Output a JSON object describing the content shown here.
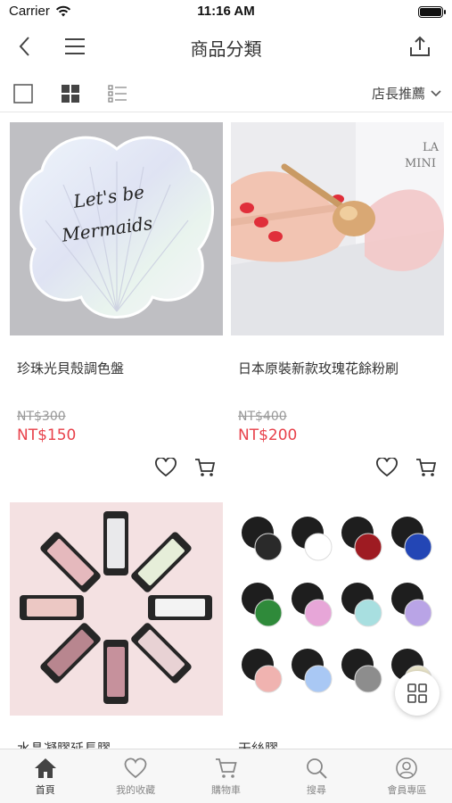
{
  "status": {
    "carrier": "Carrier",
    "time": "11:16 AM"
  },
  "nav": {
    "title": "商品分類",
    "back_icon": "chevron-left-icon",
    "menu_icon": "menu-icon",
    "share_icon": "share-icon"
  },
  "toolbar": {
    "sort_label": "店長推薦",
    "views": [
      "single-view-icon",
      "grid-view-icon",
      "list-view-icon"
    ],
    "active_view": "grid"
  },
  "products": [
    {
      "name": "珍珠光貝殼調色盤",
      "old_price": "NT$300",
      "price": "NT$150",
      "image_text_1": "Let's be",
      "image_text_2": "Mermaids"
    },
    {
      "name": "日本原裝新款玫瑰花餘粉刷",
      "old_price": "NT$400",
      "price": "NT$200",
      "image_text_1": "LA",
      "image_text_2": "MINI"
    },
    {
      "name": "水晶凝膠延長膠"
    },
    {
      "name": "天絲膠"
    }
  ],
  "tabs": [
    {
      "label": "首頁",
      "icon": "home-icon",
      "active": true
    },
    {
      "label": "我的收藏",
      "icon": "heart-icon",
      "active": false
    },
    {
      "label": "購物車",
      "icon": "cart-icon",
      "active": false
    },
    {
      "label": "搜尋",
      "icon": "search-icon",
      "active": false
    },
    {
      "label": "會員專區",
      "icon": "user-icon",
      "active": false
    }
  ],
  "colors": {
    "accent_price": "#e8414a",
    "text": "#333333",
    "tab_bg": "#f7f7f7"
  }
}
